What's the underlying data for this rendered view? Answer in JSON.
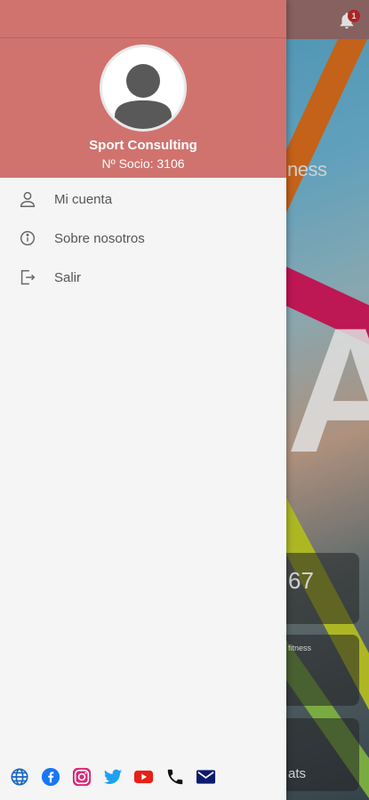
{
  "background": {
    "notification_count": "1",
    "fitness_text": "ness",
    "big_letter": "A",
    "card1_text": "67",
    "card2_text": "fitness",
    "card3_text": "ats"
  },
  "drawer": {
    "user": {
      "name": "Sport Consulting",
      "member_number": "Nº Socio: 3106"
    },
    "menu": [
      {
        "label": "Mi cuenta",
        "icon": "user-icon"
      },
      {
        "label": "Sobre nosotros",
        "icon": "info-icon"
      },
      {
        "label": "Salir",
        "icon": "logout-icon"
      }
    ],
    "social": [
      {
        "icon": "globe-icon",
        "color": "#1565c0"
      },
      {
        "icon": "facebook-icon",
        "color": "#1877f2"
      },
      {
        "icon": "instagram-icon",
        "color": "#d62976"
      },
      {
        "icon": "twitter-icon",
        "color": "#1da1f2"
      },
      {
        "icon": "youtube-icon",
        "color": "#e62117"
      },
      {
        "icon": "phone-icon",
        "color": "#111111"
      },
      {
        "icon": "mail-icon",
        "color": "#0d1b6e"
      }
    ]
  },
  "colors": {
    "header": "#d0736f",
    "drawer_bg": "#f5f5f5"
  }
}
